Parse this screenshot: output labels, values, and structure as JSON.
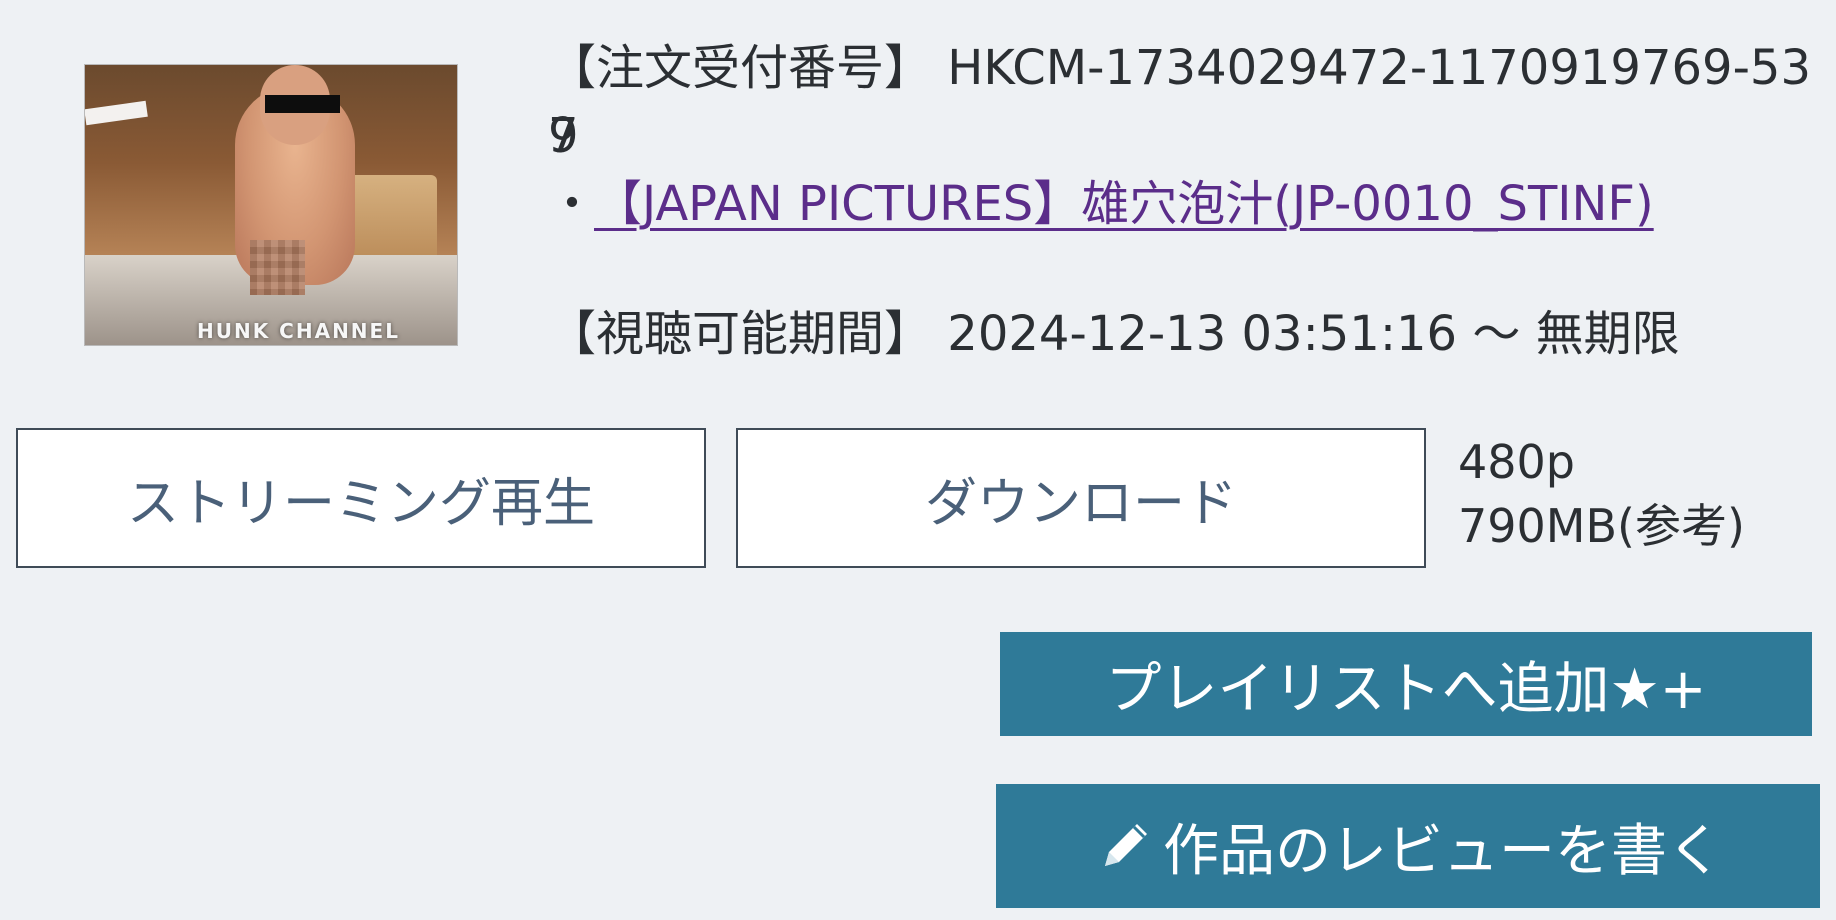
{
  "thumbnail": {
    "watermark": "HUNK CHANNEL"
  },
  "order": {
    "label": "【注文受付番号】",
    "number_part1": "HKCM-1734029472-1170919769-539",
    "number_part2": "7"
  },
  "product": {
    "bullet": "・",
    "title": "【JAPAN PICTURES】雄穴泡汁(JP-0010_STINF)"
  },
  "viewing_period": {
    "label": "【視聴可能期間】",
    "value": "2024-12-13 03:51:16 ～ 無期限"
  },
  "actions": {
    "stream_label": "ストリーミング再生",
    "download_label": "ダウンロード",
    "quality_resolution": "480p",
    "quality_size": "790MB(参考)",
    "playlist_label": "プレイリストへ追加★+",
    "review_label": "作品のレビューを書く"
  },
  "icons": {
    "review": "pencil-icon"
  },
  "colors": {
    "background": "#eef1f4",
    "primary_button": "#2f7a98",
    "link": "#5b2d8a",
    "outline_button_text": "#4a6079"
  }
}
